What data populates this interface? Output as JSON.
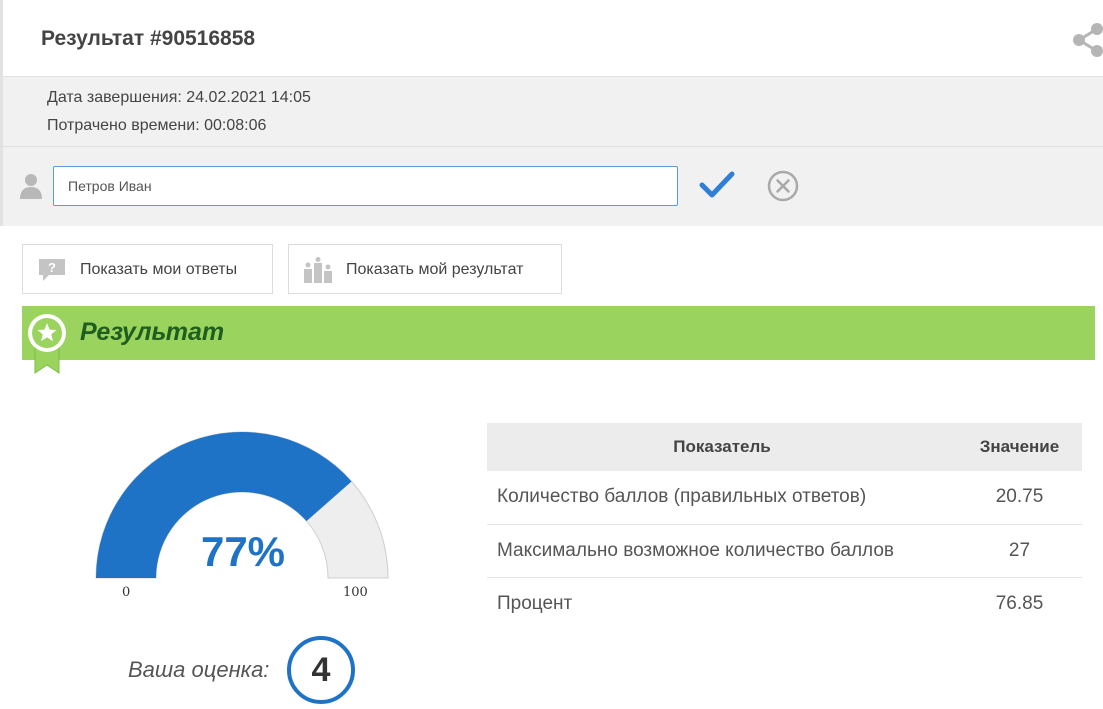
{
  "header": {
    "title": "Результат #90516858",
    "share_icon": "share-icon"
  },
  "meta": {
    "completed_label": "Дата завершения:",
    "completed_value": "24.02.2021 14:05",
    "time_label": "Потрачено времени:",
    "time_value": "00:08:06"
  },
  "name_row": {
    "name_value": "Петров Иван",
    "icons": [
      "user-icon",
      "check-icon",
      "cancel-icon"
    ]
  },
  "buttons": {
    "show_answers": "Показать мои ответы",
    "show_result": "Показать мой результат"
  },
  "result": {
    "title": "Результат"
  },
  "gauge": {
    "percent": 77,
    "percent_label": "77%",
    "min_label": "0",
    "max_label": "100",
    "fill_color": "#1f73c7",
    "track_color": "#eeeeee"
  },
  "grade": {
    "label": "Ваша оценка:",
    "value": "4"
  },
  "table": {
    "headers": [
      "Показатель",
      "Значение"
    ],
    "rows": [
      {
        "indicator": "Количество баллов (правильных ответов)",
        "value": "20.75"
      },
      {
        "indicator": "Максимально возможное количество баллов",
        "value": "27"
      },
      {
        "indicator": "Процент",
        "value": "76.85"
      }
    ]
  },
  "colors": {
    "accent_blue": "#1f73c7",
    "result_bar": "#9bd35f",
    "result_title": "#1e5e1e"
  }
}
